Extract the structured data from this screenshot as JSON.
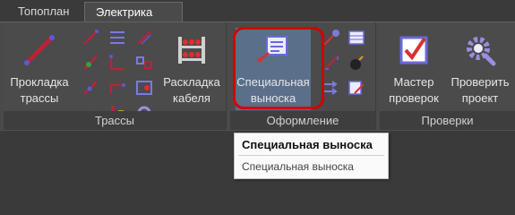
{
  "tabs": [
    {
      "label": "Топоплан"
    },
    {
      "label": "Электрика"
    }
  ],
  "panels": {
    "trassy": {
      "title": "Трассы",
      "btn_prokladka": "Прокладка\nтрассы",
      "btn_raskladka": "Раскладка\nкабеля"
    },
    "oformlenie": {
      "title": "Оформление",
      "btn_special": "Специальная\nвыноска"
    },
    "proverki": {
      "title": "Проверки",
      "btn_master": "Мастер\nпроверок",
      "btn_check": "Проверить\nпроект"
    }
  },
  "tooltip": {
    "title": "Специальная выноска",
    "description": "Специальная выноска"
  },
  "colors": {
    "accent_highlight": "#d40000"
  },
  "icons": {
    "prokladka": "diagonal-route-icon",
    "raskladka": "cable-rack-icon",
    "special": "callout-note-icon",
    "master": "checkmark-box-icon",
    "check": "gear-magnifier-icon"
  }
}
